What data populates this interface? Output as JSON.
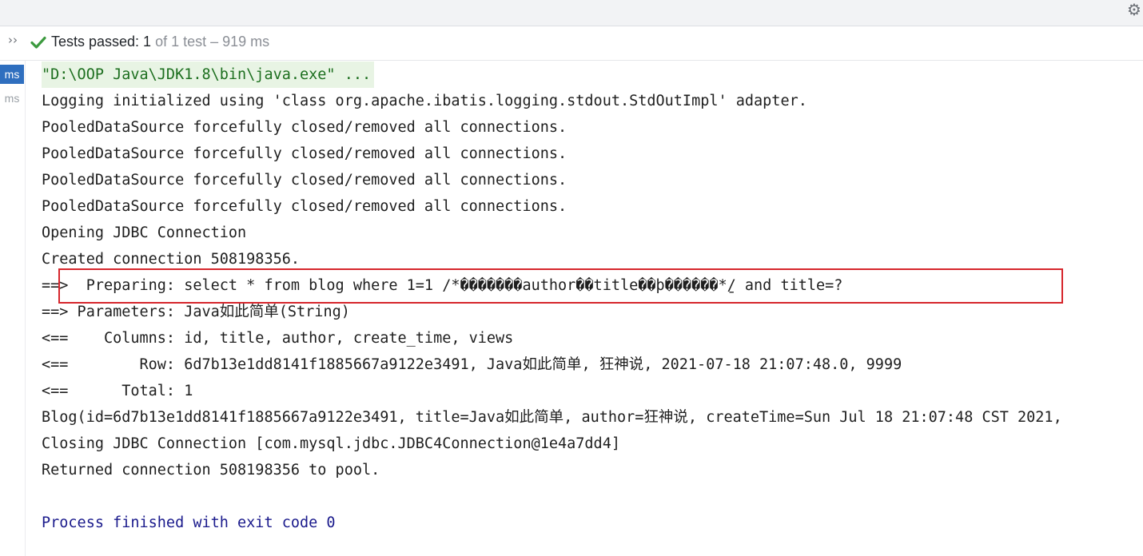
{
  "toolbar": {
    "settings_icon": "gear-icon",
    "expand_icon": "double-chevron-right-icon",
    "expand_glyph": "››"
  },
  "status": {
    "icon": "check-icon",
    "passed_text": "Tests passed: 1",
    "suffix_text": " of 1 test – 919 ms"
  },
  "gutter": {
    "items": [
      {
        "label": "ms",
        "selected": true
      },
      {
        "label": "ms",
        "selected": false
      }
    ]
  },
  "console": {
    "lines": [
      "\"D:\\OOP Java\\JDK1.8\\bin\\java.exe\" ...",
      "Logging initialized using 'class org.apache.ibatis.logging.stdout.StdOutImpl' adapter.",
      "PooledDataSource forcefully closed/removed all connections.",
      "PooledDataSource forcefully closed/removed all connections.",
      "PooledDataSource forcefully closed/removed all connections.",
      "PooledDataSource forcefully closed/removed all connections.",
      "Opening JDBC Connection",
      "Created connection 508198356.",
      "==>  Preparing: select * from blog where 1=1 /*�������author��title��þ������*̱/ and title=?",
      "==> Parameters: Java如此简单(String)",
      "<==    Columns: id, title, author, create_time, views",
      "<==        Row: 6d7b13e1dd8141f1885667a9122e3491, Java如此简单, 狂神说, 2021-07-18 21:07:48.0, 9999",
      "<==      Total: 1",
      "Blog(id=6d7b13e1dd8141f1885667a9122e3491, title=Java如此简单, author=狂神说, createTime=Sun Jul 18 21:07:48 CST 2021,",
      "Closing JDBC Connection [com.mysql.jdbc.JDBC4Connection@1e4a7dd4]",
      "Returned connection 508198356 to pool.",
      "",
      "Process finished with exit code 0"
    ]
  },
  "colors": {
    "accent_selected": "#2f6fbf",
    "check_green": "#3c9a3f",
    "highlight_red": "#d6262c",
    "final_line": "#1a1a8c"
  }
}
